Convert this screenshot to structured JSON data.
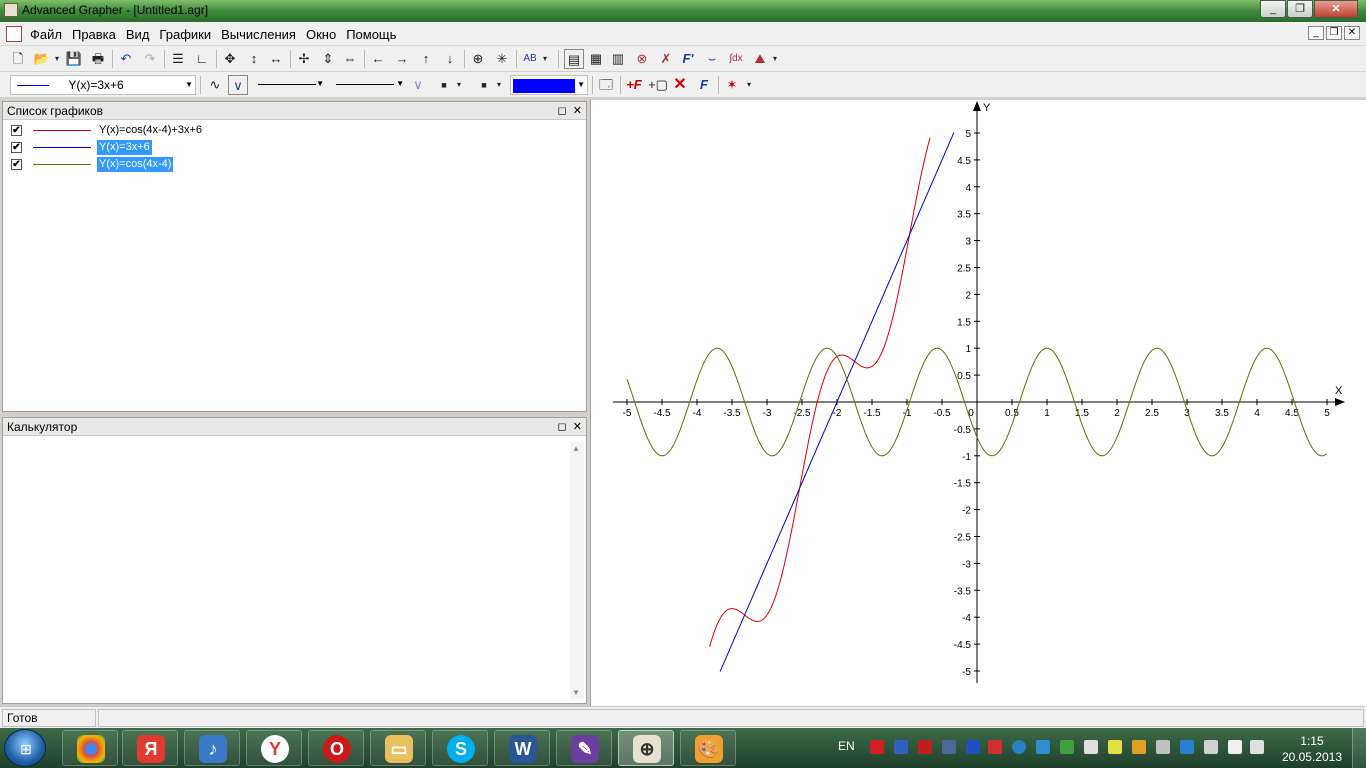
{
  "window": {
    "title": "Advanced Grapher - [Untitled1.agr]"
  },
  "menu": [
    "Файл",
    "Правка",
    "Вид",
    "Графики",
    "Вычисления",
    "Окно",
    "Помощь"
  ],
  "toolbar2": {
    "graph_select_value": "Y(x)=3x+6",
    "color_accent": "#0000ff"
  },
  "graph_list_panel": {
    "title": "Список графиков",
    "items": [
      {
        "label": "Y(x)=cos(4x-4)+3x+6",
        "color": "#e00000",
        "checked": true,
        "selected": false
      },
      {
        "label": "Y(x)=3x+6",
        "color": "#0000cc",
        "checked": true,
        "selected": true
      },
      {
        "label": "Y(x)=cos(4x-4)",
        "color": "#6b6b00",
        "checked": true,
        "selected": true
      }
    ]
  },
  "calculator_panel": {
    "title": "Калькулятор"
  },
  "status": {
    "text": "Готов"
  },
  "chart_data": {
    "type": "line",
    "title": "",
    "xlabel": "X",
    "ylabel": "Y",
    "xlim": [
      -5,
      5
    ],
    "ylim": [
      -5,
      5
    ],
    "x_ticks": [
      "-5",
      "-4.5",
      "-4",
      "-3.5",
      "-3",
      "-2.5",
      "-2",
      "-1.5",
      "-1",
      "-0.5",
      "0",
      "0.5",
      "1",
      "1.5",
      "2",
      "2.5",
      "3",
      "3.5",
      "4",
      "4.5",
      "5"
    ],
    "y_ticks": [
      "-5",
      "-4.5",
      "-4",
      "-3.5",
      "-3",
      "-2.5",
      "-2",
      "-1.5",
      "-1",
      "-0.5",
      "0.5",
      "1",
      "1.5",
      "2",
      "2.5",
      "3",
      "3.5",
      "4",
      "4.5",
      "5"
    ],
    "series": [
      {
        "name": "Y(x)=cos(4x-4)+3x+6",
        "color": "#e00000",
        "x": [
          -3.82,
          -3.6,
          -3.4,
          -3.2,
          -3.0,
          -2.8,
          -2.6,
          -2.4,
          -2.2,
          -2.0,
          -1.8,
          -1.6,
          -1.4,
          -1.2,
          -1.0,
          -0.8,
          -0.67
        ],
        "y": [
          -5.0,
          -3.97,
          -3.86,
          -4.07,
          -3.85,
          -2.94,
          -1.7,
          -0.6,
          0.15,
          0.76,
          0.86,
          0.73,
          0.8,
          1.85,
          3.15,
          4.22,
          5.0
        ]
      },
      {
        "name": "Y(x)=3x+6",
        "color": "#0000cc",
        "x": [
          -3.67,
          -0.33
        ],
        "y": [
          -5.0,
          5.0
        ]
      },
      {
        "name": "Y(x)=cos(4x-4)",
        "color": "#6b6b00",
        "x": [
          -5.0,
          5.0
        ],
        "y": [
          0.41,
          -0.99
        ]
      }
    ],
    "grid": false,
    "legend": "none"
  }
}
